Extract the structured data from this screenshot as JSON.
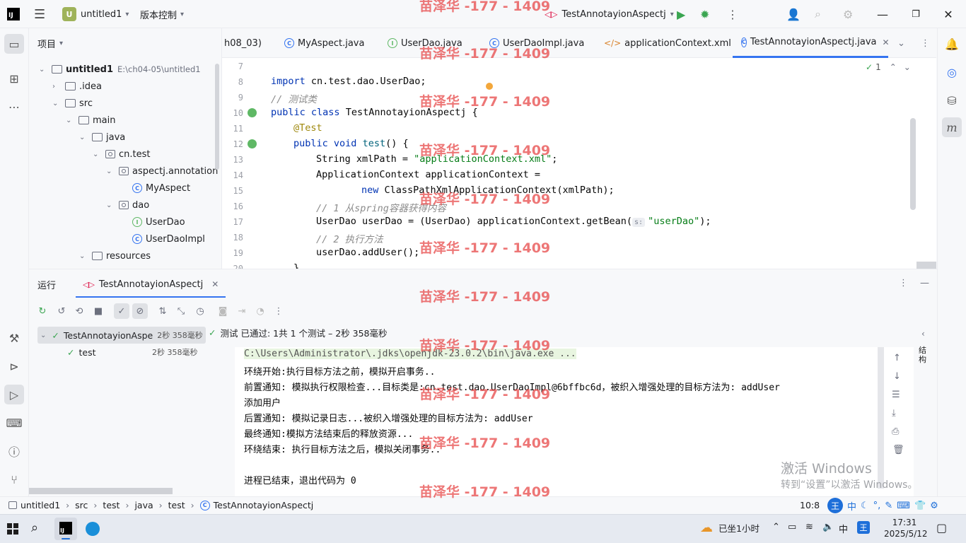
{
  "titlebar": {
    "project_badge": "U",
    "project_name": "untitled1",
    "vcs_menu": "版本控制",
    "run_config": "TestAnnotayionAspectj"
  },
  "project_pane": {
    "title": "项目",
    "tree": [
      {
        "label": "untitled1",
        "extra": "E:\\ch04-05\\untitled1",
        "icon": "folder-icon",
        "chev": "v",
        "indent": 0
      },
      {
        "label": ".idea",
        "icon": "folder-icon",
        "chev": ">",
        "indent": 1
      },
      {
        "label": "src",
        "icon": "folder-icon",
        "chev": "v",
        "indent": 1
      },
      {
        "label": "main",
        "icon": "folder-icon",
        "chev": "v",
        "indent": 2
      },
      {
        "label": "java",
        "icon": "folder-icon",
        "chev": "v",
        "indent": 3
      },
      {
        "label": "cn.test",
        "icon": "package-icon",
        "chev": "v",
        "indent": 4
      },
      {
        "label": "aspectj.annotation",
        "icon": "package-icon",
        "chev": "v",
        "indent": 5
      },
      {
        "label": "MyAspect",
        "icon": "class-icon",
        "chev": "",
        "indent": 6
      },
      {
        "label": "dao",
        "icon": "package-icon",
        "chev": "v",
        "indent": 5
      },
      {
        "label": "UserDao",
        "icon": "interface-icon",
        "chev": "",
        "indent": 6
      },
      {
        "label": "UserDaoImpl",
        "icon": "class-icon",
        "chev": "",
        "indent": 6
      },
      {
        "label": "resources",
        "icon": "folder-icon",
        "chev": "v",
        "indent": 3
      }
    ]
  },
  "editor_tabs": [
    {
      "label": "h08_03)",
      "icon": ""
    },
    {
      "label": "MyAspect.java",
      "icon": "class-icon"
    },
    {
      "label": "UserDao.java",
      "icon": "interface-icon"
    },
    {
      "label": "UserDaoImpl.java",
      "icon": "class-icon"
    },
    {
      "label": "applicationContext.xml",
      "icon": "xml-icon"
    },
    {
      "label": "TestAnnotayionAspectj.java",
      "icon": "class-icon",
      "active": true
    }
  ],
  "editor": {
    "inspection_count": "1",
    "param_hint": "s:",
    "lines": [
      {
        "num": "7"
      },
      {
        "num": "8",
        "kw1": "import",
        "text1": " cn.test.dao.UserDao;"
      },
      {
        "num": "9",
        "comment": "// 测试类"
      },
      {
        "num": "10",
        "kw1": "public",
        "kw2": "class",
        "text1": " TestAnnotayionAspectj {"
      },
      {
        "num": "11",
        "annotation": "@Test"
      },
      {
        "num": "12",
        "kw1": "public",
        "kw2": "void",
        "fn": "test",
        "text1": "() {"
      },
      {
        "num": "13",
        "text0": "String xmlPath = ",
        "str": "\"applicationContext.xml\"",
        "text1": ";"
      },
      {
        "num": "14",
        "text0": "ApplicationContext applicationContext ="
      },
      {
        "num": "15",
        "kw1": "new",
        "text1": " ClassPathXmlApplicationContext(xmlPath);"
      },
      {
        "num": "16",
        "comment": "// 1 从spring容器获得内容"
      },
      {
        "num": "17",
        "text0": "UserDao userDao = (UserDao) applicationContext.getBean(",
        "str": "\"userDao\"",
        "text1": ");"
      },
      {
        "num": "18",
        "comment": "// 2 执行方法"
      },
      {
        "num": "19",
        "text0": "userDao.addUser();"
      },
      {
        "num": "20",
        "text0": "}"
      }
    ]
  },
  "run_window": {
    "title": "运行",
    "tab": "TestAnnotayionAspectj",
    "status": "测试 已通过: 1共 1 个测试 – 2秒 358毫秒",
    "tests": [
      {
        "name": "TestAnnotayionAspe",
        "time": "2秒 358毫秒"
      },
      {
        "name": "test",
        "time": "2秒 358毫秒"
      }
    ],
    "console": [
      "C:\\Users\\Administrator\\.jdks\\openjdk-23.0.2\\bin\\java.exe ...",
      "环绕开始:执行目标方法之前，模拟开启事务..",
      "前置通知: 模拟执行权限检查...目标类是:cn.test.dao.UserDaoImpl@6bffbc6d，被织入增强处理的目标方法为: addUser",
      "添加用户",
      "后置通知: 模拟记录日志...被织入增强处理的目标方法为: addUser",
      "最终通知:模拟方法结束后的释放资源...",
      "环绕结束: 执行目标方法之后，模拟关闭事务..",
      "",
      "进程已结束，退出代码为 0"
    ],
    "right_stripe_label": "结构"
  },
  "statusbar": {
    "breadcrumbs": [
      "untitled1",
      "src",
      "test",
      "java",
      "test",
      "TestAnnotayionAspectj"
    ],
    "position": "10:8"
  },
  "taskbar": {
    "weather": "已坐1小时",
    "ime": "中",
    "time": "17:31",
    "date": "2025/5/12"
  },
  "activate_windows": {
    "line1": "激活 Windows",
    "line2": "转到“设置”以激活 Windows。"
  },
  "watermark": "苗泽华 -177 - 1409",
  "colors": {
    "accent": "#3574f0",
    "keyword": "#0033b3",
    "string": "#067d17",
    "comment": "#8c8c8c",
    "annotation": "#9e880d",
    "success": "#5fb865"
  }
}
